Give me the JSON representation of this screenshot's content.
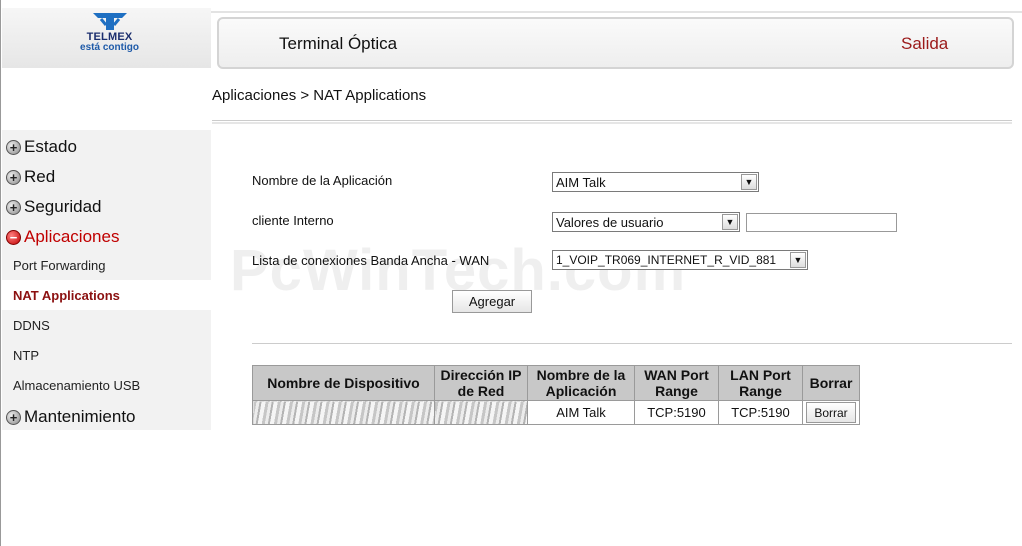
{
  "brand": {
    "name": "TELMEX",
    "tagline": "está contigo"
  },
  "header": {
    "title": "Terminal Óptica",
    "exit": "Salida"
  },
  "menu": {
    "categories": [
      {
        "label": "Estado"
      },
      {
        "label": "Red"
      },
      {
        "label": "Seguridad"
      },
      {
        "label": "Aplicaciones"
      },
      {
        "label": "Mantenimiento"
      }
    ],
    "sub_items": [
      {
        "label": "Port Forwarding"
      },
      {
        "label": "NAT Applications"
      },
      {
        "label": "DDNS"
      },
      {
        "label": "NTP"
      },
      {
        "label": "Almacenamiento USB"
      }
    ]
  },
  "breadcrumb": "Aplicaciones > NAT Applications",
  "form": {
    "app_name_label": "Nombre de la Aplicación",
    "app_name_value": "AIM Talk",
    "client_label": "cliente Interno",
    "client_value": "Valores de usuario",
    "client_input_value": "",
    "wan_label": "Lista de conexiones Banda Ancha - WAN",
    "wan_value": "1_VOIP_TR069_INTERNET_R_VID_881",
    "add_label": "Agregar"
  },
  "table": {
    "headers": [
      "Nombre de Dispositivo",
      "Dirección IP de Red",
      "Nombre de la Aplicación",
      "WAN Port Range",
      "LAN Port Range",
      "Borrar"
    ],
    "rows": [
      {
        "app": "AIM Talk",
        "wan": "TCP:5190",
        "lan": "TCP:5190",
        "delete": "Borrar"
      }
    ]
  },
  "watermark": "PcWinTech.com"
}
